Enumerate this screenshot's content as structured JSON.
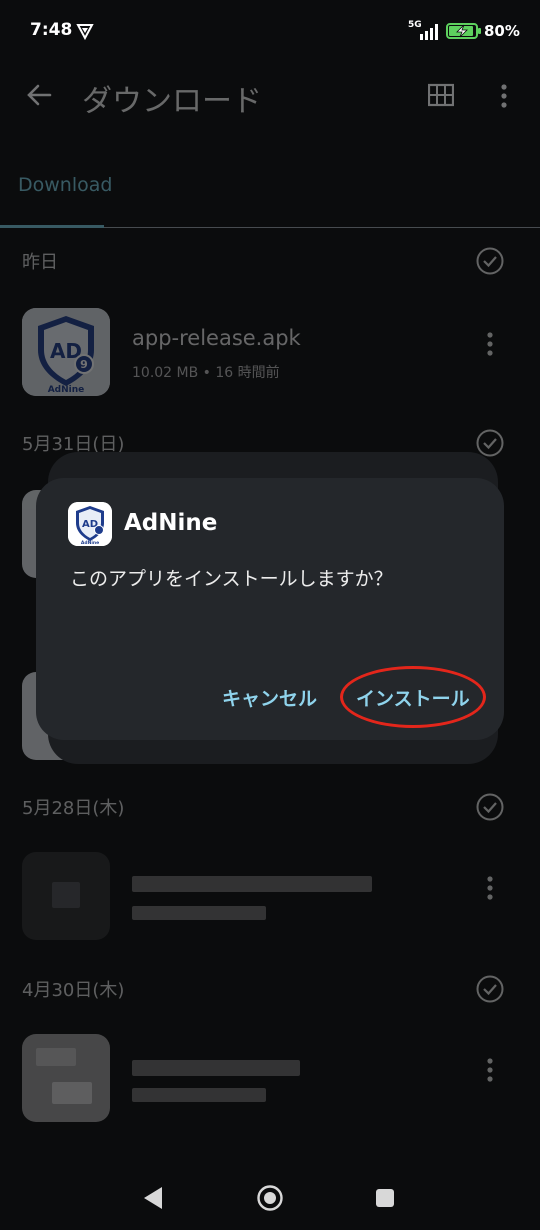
{
  "status_bar": {
    "time": "7:48",
    "network": "5G",
    "battery": "80%"
  },
  "app_bar": {
    "title": "ダウンロード"
  },
  "tabs": [
    {
      "label": "Download",
      "selected": true
    }
  ],
  "sections": [
    {
      "header": "昨日",
      "files": [
        {
          "name": "app-release.apk",
          "meta": "10.02 MB • 16 時間前"
        }
      ]
    },
    {
      "header": "5月31日(日)"
    },
    {
      "header": "5月28日(木)"
    },
    {
      "header": "4月30日(木)"
    }
  ],
  "dialog": {
    "app_name": "AdNine",
    "message": "このアプリをインストールしますか？",
    "cancel_label": "キャンセル",
    "install_label": "インストール"
  },
  "icon_logo_text": {
    "main": "AD",
    "badge": "9",
    "caption": "AdNine"
  },
  "colors": {
    "accent": "#8fd3ec",
    "tab_accent": "#77c7d9",
    "highlight": "#e3261b",
    "dialog_bg": "#24272b"
  }
}
